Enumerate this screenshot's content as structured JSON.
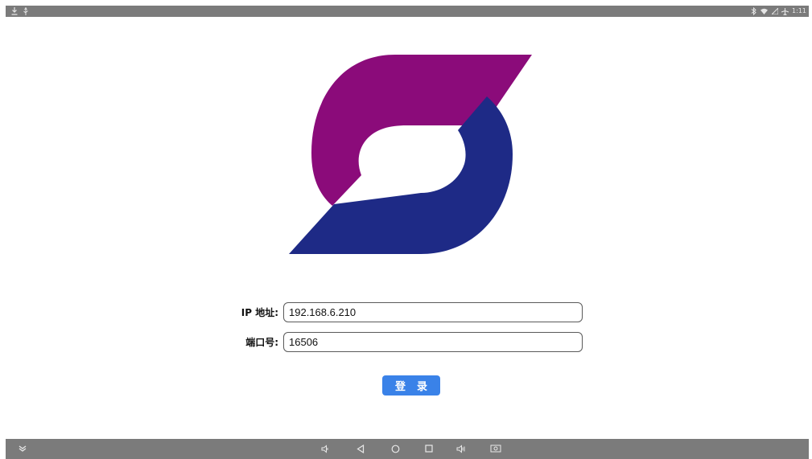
{
  "status_bar": {
    "left_icons": [
      "download-icon",
      "usb-icon"
    ],
    "right_icons": [
      "bluetooth-icon",
      "wifi-icon",
      "signal-icon",
      "airplane-icon"
    ],
    "time": "1:11"
  },
  "logo": {
    "top_color": "#8b0b7a",
    "bottom_color": "#1e2a86"
  },
  "form": {
    "ip_label": "IP 地址:",
    "ip_value": "192.168.6.210",
    "port_label": "端口号:",
    "port_value": "16506",
    "login_label": "登录"
  },
  "nav_bar": {
    "buttons": [
      "expand-icon",
      "volume-down-icon",
      "back-icon",
      "home-icon",
      "recents-icon",
      "volume-up-icon",
      "screenshot-icon"
    ]
  },
  "colors": {
    "button": "#3a82e8",
    "bars": "#7b7b7b"
  }
}
